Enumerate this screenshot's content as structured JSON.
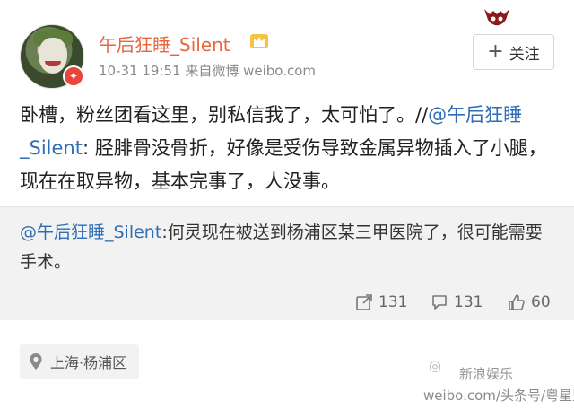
{
  "post": {
    "username": "午后狂睡_Silent",
    "meta": "10-31 19:51  来自微博 weibo.com",
    "follow_label": "关注",
    "content_before": "卧槽，粉丝团看这里，别私信我了，太可怕了。//",
    "content_mention": "@午后狂睡_Silent",
    "content_after": ": 胫腓骨没骨折，好像是受伤导致金属异物插入了小腿，现在在取异物，基本完事了，人没事。"
  },
  "repost": {
    "mention": "@午后狂睡_Silent",
    "text": ":何灵现在被送到杨浦区某三甲医院了，很可能需要手术。",
    "repost_count": "131",
    "comment_count": "131",
    "like_count": "60"
  },
  "location": {
    "label": "上海·杨浦区"
  },
  "watermark": {
    "line1": "新浪娱乐",
    "line2": "weibo.com/头条号/粤星监督"
  },
  "colors": {
    "username": "#e8663d",
    "mention": "#2f6db5",
    "repost_bg": "#f2f2f2",
    "verified": "#e8463b"
  },
  "icons": {
    "verified": "v-badge-icon",
    "crown": "crown-icon",
    "repost": "repost-icon",
    "comment": "comment-icon",
    "like": "thumb-up-icon",
    "location": "location-pin-icon"
  }
}
